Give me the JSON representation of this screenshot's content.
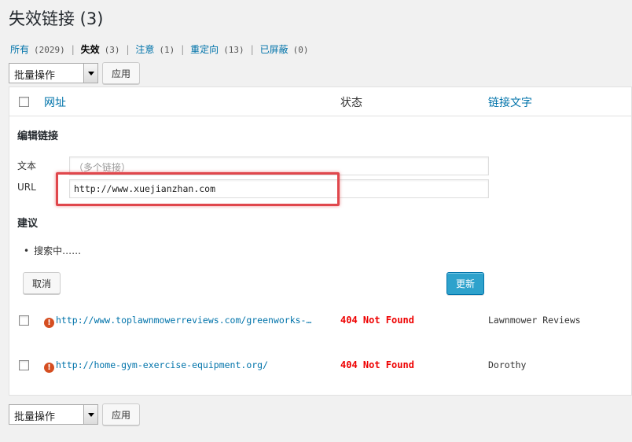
{
  "page": {
    "title": "失效链接 (3)"
  },
  "filters": [
    {
      "label": "所有",
      "count": "(2029)",
      "current": false
    },
    {
      "label": "失效",
      "count": "(3)",
      "current": true
    },
    {
      "label": "注意",
      "count": "(1)",
      "current": false
    },
    {
      "label": "重定向",
      "count": "(13)",
      "current": false
    },
    {
      "label": "已屏蔽",
      "count": "(0)",
      "current": false
    }
  ],
  "filter_separator": "|",
  "bulk": {
    "select_value": "批量操作",
    "apply_label": "应用"
  },
  "table": {
    "headers": {
      "url": "网址",
      "status": "状态",
      "anchor": "链接文字"
    },
    "edit": {
      "title": "编辑链接",
      "text_label": "文本",
      "text_placeholder": "（多个链接）",
      "url_label": "URL",
      "url_value": "http://www.xuejianzhan.com",
      "suggestions_title": "建议",
      "searching": "搜索中……",
      "cancel_label": "取消",
      "update_label": "更新"
    },
    "rows": [
      {
        "url": "http://www.toplawnmowerreviews.com/greenworks-…",
        "status": "404 Not Found",
        "anchor": "Lawnmower Reviews"
      },
      {
        "url": "http://home-gym-exercise-equipment.org/",
        "status": "404 Not Found",
        "anchor": "Dorothy"
      }
    ]
  },
  "icons": {
    "error": "error-icon",
    "select_arrow": "chevron-down-icon"
  },
  "colors": {
    "link": "#0073aa",
    "error": "#e00000",
    "primary_button": "#2ea2cc",
    "highlight": "#e0474c"
  }
}
